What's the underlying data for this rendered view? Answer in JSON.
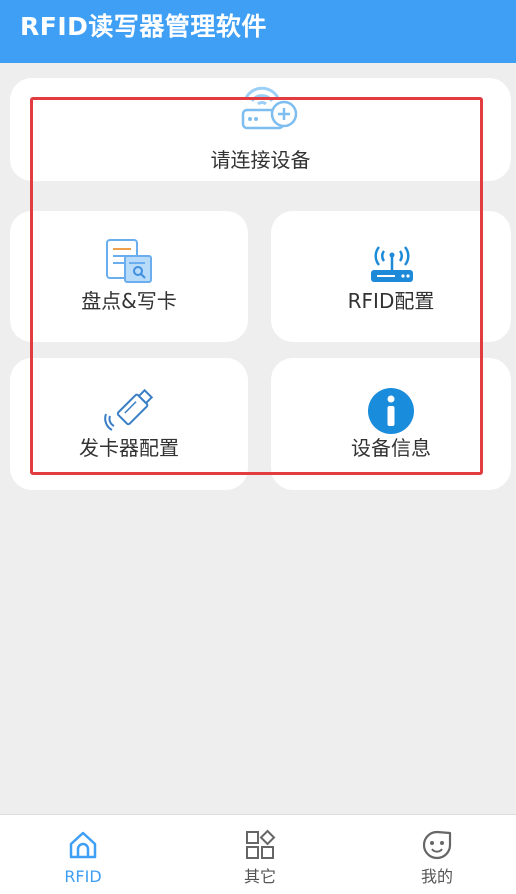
{
  "header": {
    "title": "RFID读写器管理软件"
  },
  "cards": {
    "connect": {
      "label": "请连接设备",
      "icon": "router-add-icon"
    },
    "inventory": {
      "label": "盘点&写卡",
      "icon": "document-search-icon"
    },
    "rfid_config": {
      "label": "RFID配置",
      "icon": "wireless-router-icon"
    },
    "issuer_config": {
      "label": "发卡器配置",
      "icon": "usb-stick-icon"
    },
    "device_info": {
      "label": "设备信息",
      "icon": "info-icon"
    }
  },
  "tabs": [
    {
      "label": "RFID",
      "icon": "home-icon",
      "active": true
    },
    {
      "label": "其它",
      "icon": "apps-grid-icon",
      "active": false
    },
    {
      "label": "我的",
      "icon": "smiley-icon",
      "active": false
    }
  ],
  "colors": {
    "primary": "#3f9ff5",
    "highlight": "#e23b40",
    "background": "#eeeeee"
  }
}
